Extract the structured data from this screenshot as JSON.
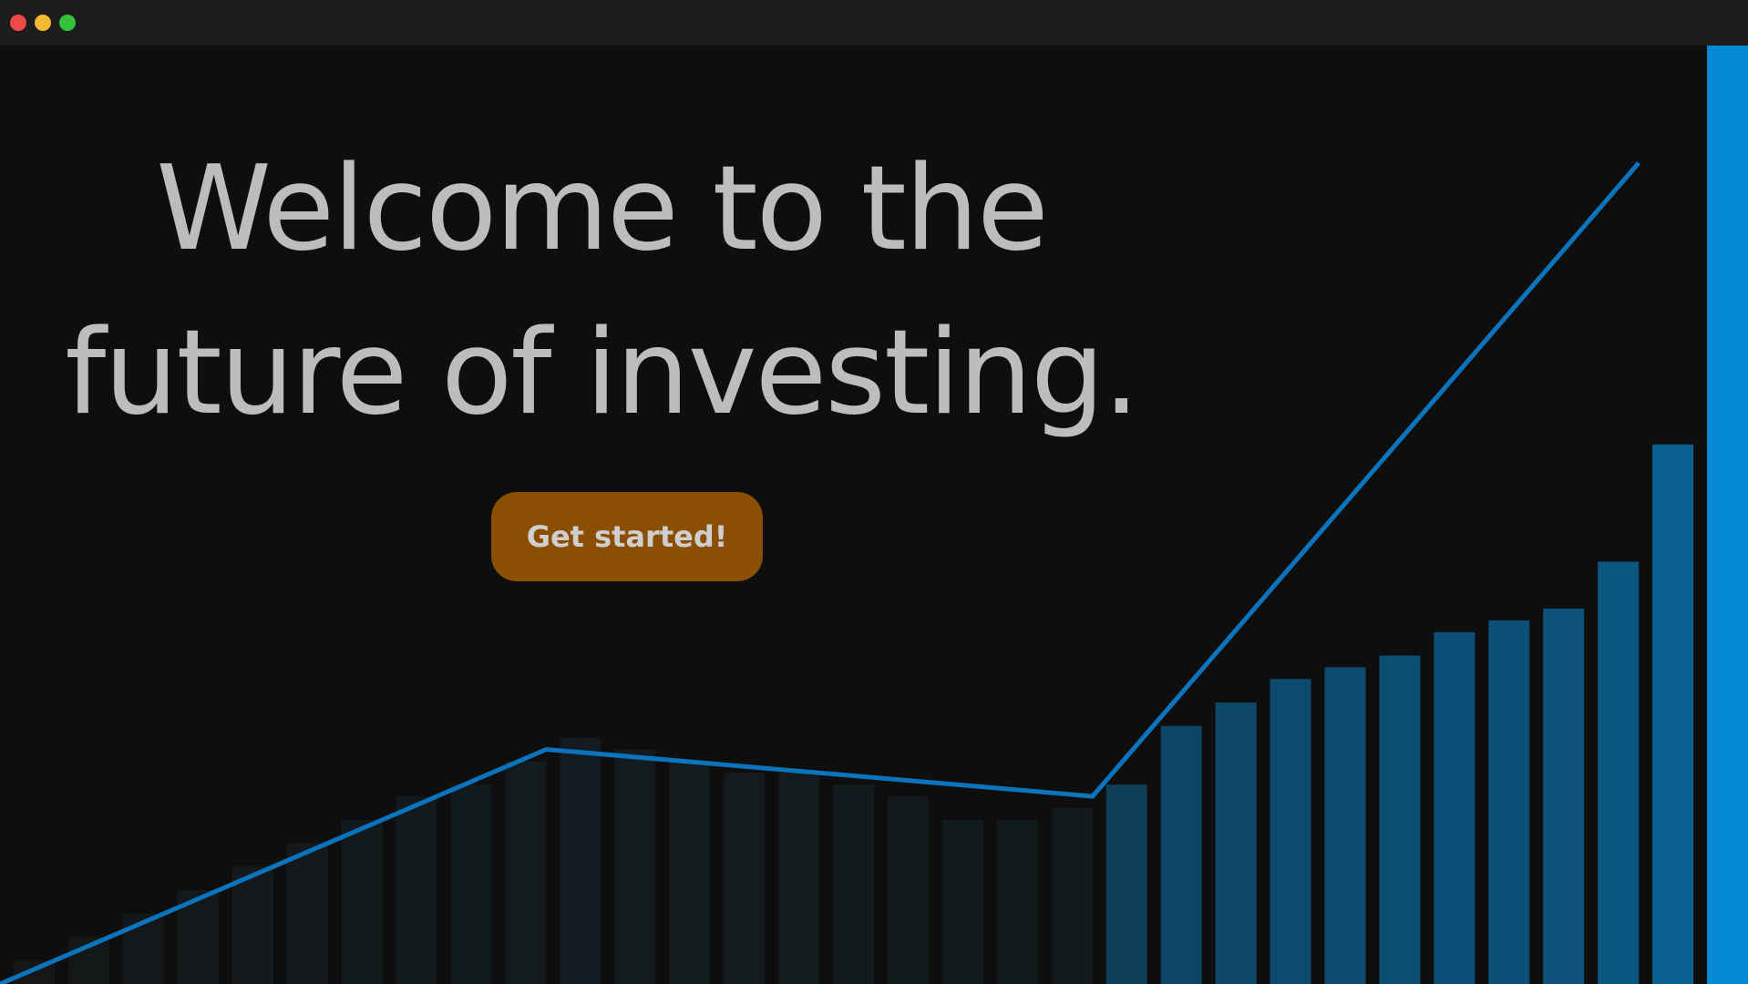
{
  "window": {
    "controls": {
      "close_color": "#ed4a46",
      "minimize_color": "#f5b931",
      "maximize_color": "#33c13a"
    }
  },
  "hero": {
    "headline_line1": "Welcome to the",
    "headline_line2": "future of investing.",
    "cta_label": "Get started!",
    "cta_color": "#8b4f03"
  },
  "chart_data": {
    "type": "line",
    "series": [
      {
        "color": "#0b74bd",
        "x": [
          0,
          1,
          2,
          3
        ],
        "values": [
          0,
          10,
          8,
          35
        ]
      }
    ],
    "xlim": [
      0,
      3.2
    ],
    "ylim": [
      0,
      40
    ],
    "grid": false,
    "bars": {
      "color_low": "#141414",
      "color_high": "#0489d6",
      "values": [
        1,
        2,
        3,
        4,
        5,
        6,
        7,
        8,
        8.5,
        9.5,
        10.5,
        10,
        9.5,
        9,
        9,
        8.5,
        8,
        7,
        7,
        7.5,
        8.5,
        11,
        12,
        13,
        13.5,
        14,
        15,
        15.5,
        16,
        18,
        23,
        47
      ]
    }
  }
}
